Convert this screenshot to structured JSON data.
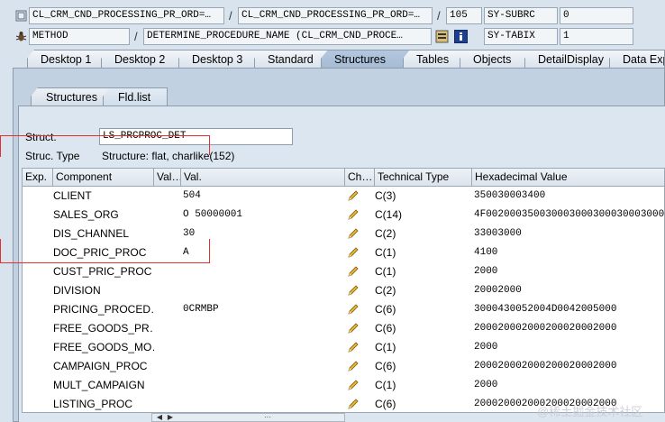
{
  "header": {
    "row1": {
      "field1": "CL_CRM_CND_PROCESSING_PR_ORD=…",
      "field2": "CL_CRM_CND_PROCESSING_PR_ORD=…",
      "line": "105",
      "var_name": "SY-SUBRC",
      "var_value": "0"
    },
    "row2": {
      "event_type": "METHOD",
      "event_name": "DETERMINE_PROCEDURE_NAME (CL_CRM_CND_PROCE…",
      "var_name": "SY-TABIX",
      "var_value": "1"
    }
  },
  "tabs": [
    "Desktop 1",
    "Desktop 2",
    "Desktop 3",
    "Standard",
    "Structures",
    "Tables",
    "Objects",
    "DetailDisplay",
    "Data Exp"
  ],
  "subtabs": [
    "Structures",
    "Fld.list"
  ],
  "struct": {
    "label": "Struct.",
    "value": "LS_PRCPROC_DET",
    "type_label": "Struc. Type",
    "type_value": "Structure: flat, charlike(152)"
  },
  "grid": {
    "columns": [
      "Exp.",
      "Component",
      "Val…",
      "Val.",
      "Ch…",
      "Technical Type",
      "Hexadecimal Value"
    ],
    "rows": [
      {
        "component": "CLIENT",
        "val": "504",
        "type": "C(3)",
        "hex": "350030003400"
      },
      {
        "component": "SALES_ORG",
        "val": "O 50000001",
        "type": "C(14)",
        "hex": "4F0020003500300030003000300030003000"
      },
      {
        "component": "DIS_CHANNEL",
        "val": "30",
        "type": "C(2)",
        "hex": "33003000"
      },
      {
        "component": "DOC_PRIC_PROC",
        "val": "A",
        "type": "C(1)",
        "hex": "4100"
      },
      {
        "component": "CUST_PRIC_PROC",
        "val": "",
        "type": "C(1)",
        "hex": "2000"
      },
      {
        "component": "DIVISION",
        "val": "",
        "type": "C(2)",
        "hex": "20002000"
      },
      {
        "component": "PRICING_PROCED…",
        "val": "0CRMBP",
        "type": "C(6)",
        "hex": "3000430052004D0042005000"
      },
      {
        "component": "FREE_GOODS_PR…",
        "val": "",
        "type": "C(6)",
        "hex": "200020002000200020002000"
      },
      {
        "component": "FREE_GOODS_MO…",
        "val": "",
        "type": "C(1)",
        "hex": "2000"
      },
      {
        "component": "CAMPAIGN_PROC",
        "val": "",
        "type": "C(6)",
        "hex": "200020002000200020002000"
      },
      {
        "component": "MULT_CAMPAIGN",
        "val": "",
        "type": "C(1)",
        "hex": "2000"
      },
      {
        "component": "LISTING_PROC",
        "val": "",
        "type": "C(6)",
        "hex": "200020002000200020002000"
      }
    ]
  },
  "scrollbar": {
    "grip": "···"
  },
  "watermark": "@稀土掘金技术社区",
  "colors": {
    "annotation": "#e03030",
    "active_tab": "#a5bbd4",
    "panel": "#c2d1e2"
  },
  "icons": {
    "breakpoint": "bug-icon",
    "watchpoint": "info-icon",
    "change": "pencil-icon"
  }
}
